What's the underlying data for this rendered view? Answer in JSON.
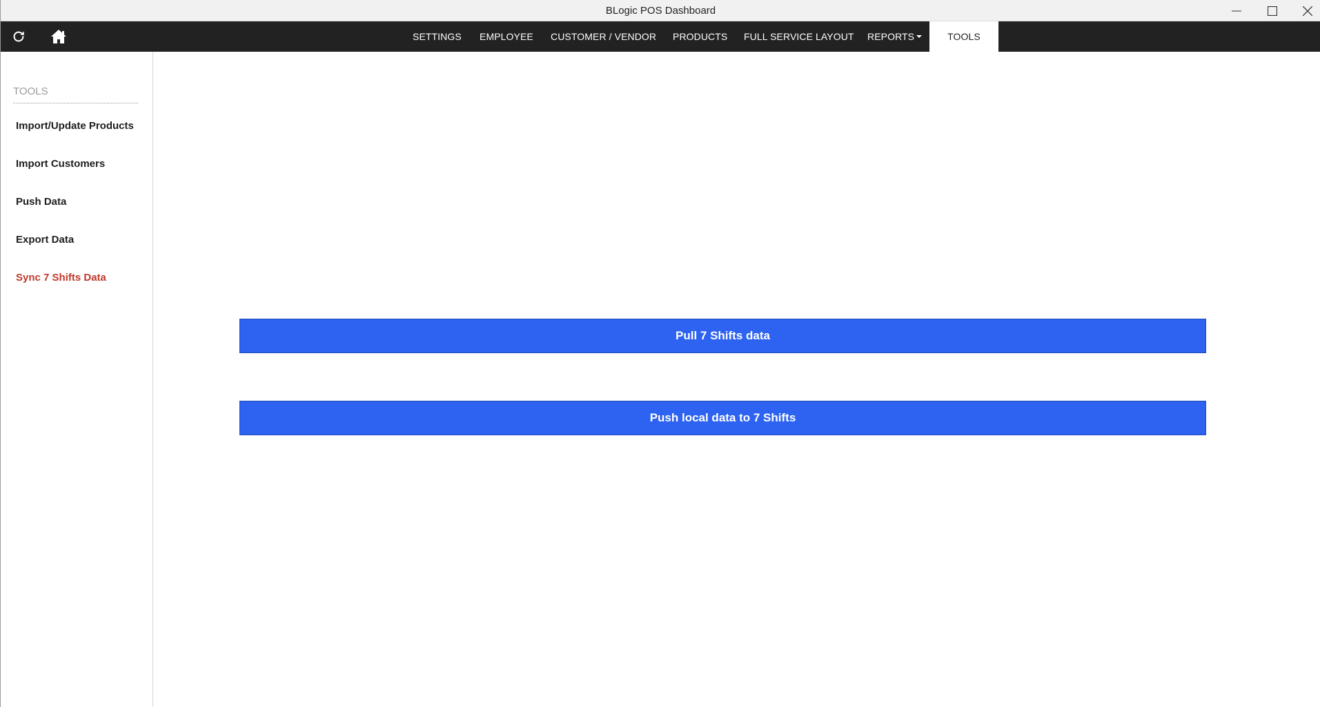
{
  "window": {
    "title": "BLogic POS Dashboard"
  },
  "icons": {
    "refresh": "refresh-icon",
    "home": "home-icon",
    "minimize": "minimize-icon",
    "maximize": "maximize-icon",
    "close": "close-icon",
    "caret": "caret-down-icon"
  },
  "nav": {
    "items": [
      {
        "label": "SETTINGS"
      },
      {
        "label": "EMPLOYEE"
      },
      {
        "label": "CUSTOMER / VENDOR"
      },
      {
        "label": "PRODUCTS"
      },
      {
        "label": "FULL SERVICE LAYOUT"
      },
      {
        "label": "REPORTS"
      },
      {
        "label": "TOOLS"
      }
    ],
    "active": "TOOLS"
  },
  "sidebar": {
    "heading": "TOOLS",
    "items": [
      {
        "label": "Import/Update Products"
      },
      {
        "label": "Import Customers"
      },
      {
        "label": "Push Data"
      },
      {
        "label": "Export Data"
      },
      {
        "label": "Sync 7 Shifts Data"
      }
    ],
    "active": "Sync 7 Shifts Data"
  },
  "main": {
    "pull_button": "Pull 7 Shifts data",
    "push_button": "Push local data to 7 Shifts"
  },
  "colors": {
    "navbar": "#222222",
    "button": "#2d63f0",
    "active_sidebar": "#c0392b"
  }
}
